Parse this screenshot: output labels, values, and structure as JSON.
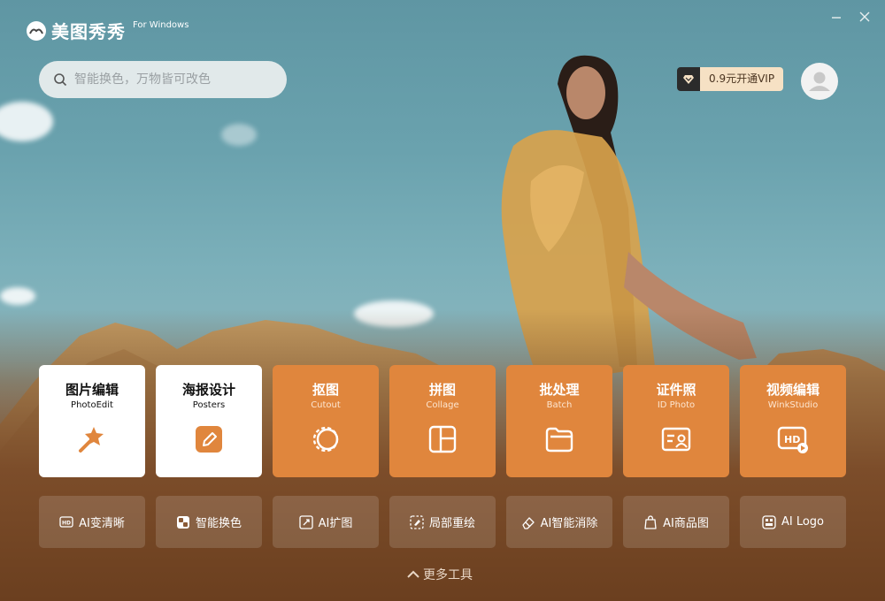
{
  "app": {
    "name": "美图秀秀",
    "platform": "For Windows"
  },
  "window": {
    "minimize_icon": "minimize-icon",
    "close_icon": "close-icon"
  },
  "search": {
    "placeholder": "智能换色，万物皆可改色"
  },
  "vip": {
    "label": "0.9元开通VIP",
    "icon": "diamond-icon"
  },
  "main_tools": [
    {
      "title": "图片编辑",
      "subtitle": "PhotoEdit",
      "icon": "magic-wand-icon",
      "style": "white"
    },
    {
      "title": "海报设计",
      "subtitle": "Posters",
      "icon": "pencil-square-icon",
      "style": "white"
    },
    {
      "title": "抠图",
      "subtitle": "Cutout",
      "icon": "cutout-circle-icon",
      "style": "orange"
    },
    {
      "title": "拼图",
      "subtitle": "Collage",
      "icon": "collage-grid-icon",
      "style": "orange"
    },
    {
      "title": "批处理",
      "subtitle": "Batch",
      "icon": "folder-icon",
      "style": "orange"
    },
    {
      "title": "证件照",
      "subtitle": "ID Photo",
      "icon": "id-card-icon",
      "style": "orange"
    },
    {
      "title": "视频编辑",
      "subtitle": "WinkStudio",
      "icon": "hd-video-icon",
      "style": "orange"
    }
  ],
  "ai_tools": [
    {
      "label": "AI变清晰",
      "icon": "hd-badge-icon"
    },
    {
      "label": "智能换色",
      "icon": "color-swap-icon"
    },
    {
      "label": "AI扩图",
      "icon": "expand-image-icon"
    },
    {
      "label": "局部重绘",
      "icon": "repaint-icon"
    },
    {
      "label": "AI智能消除",
      "icon": "eraser-icon"
    },
    {
      "label": "AI商品图",
      "icon": "product-bag-icon"
    },
    {
      "label": "AI Logo",
      "icon": "logo-grid-icon"
    }
  ],
  "more_tools": {
    "label": "更多工具",
    "icon": "chevron-up-icon"
  },
  "colors": {
    "accent_orange": "#e0863d",
    "vip_bg": "#f6e1c4"
  }
}
